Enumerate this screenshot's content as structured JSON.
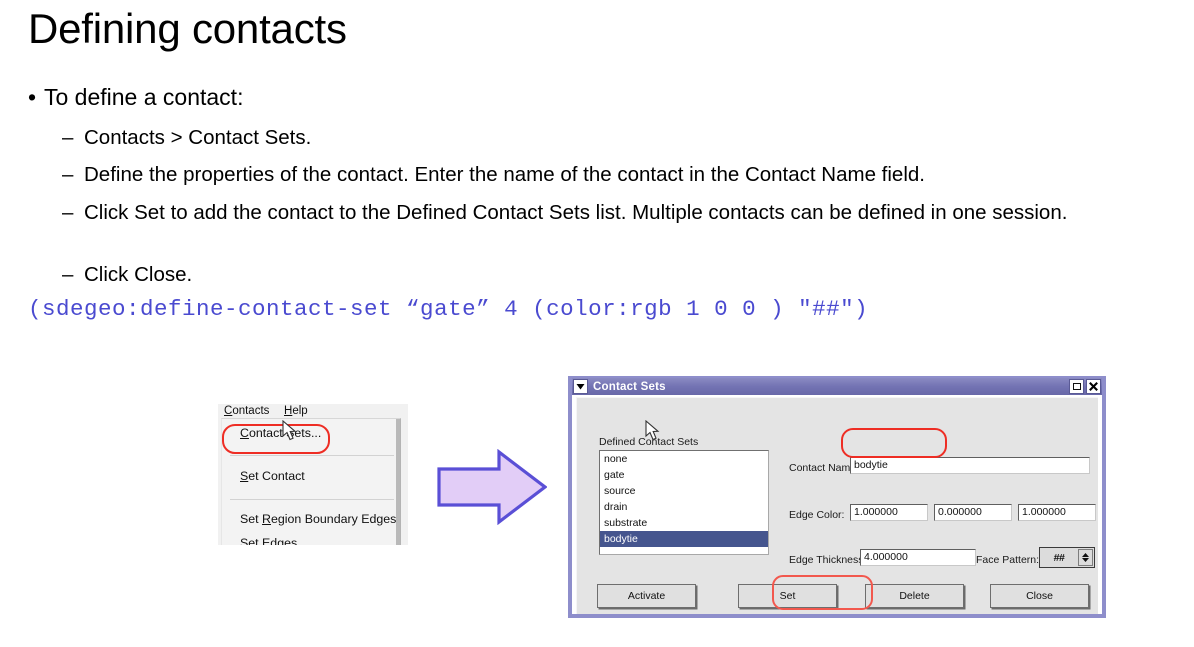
{
  "slide": {
    "title": "Defining contacts",
    "bullet": "To define a contact:",
    "bullet_marker": "•",
    "sub_marker": "–",
    "sub_bullets": [
      "Contacts > Contact Sets.",
      "Define the properties of the contact. Enter the name of the contact in the Contact Name field.",
      "Click Set to add the contact to the Defined Contact Sets list. Multiple contacts can be defined in one session.",
      "Click Close."
    ],
    "code_line": "(sdegeo:define-contact-set “gate” 4 (color:rgb 1 0 0 ) \"##\")",
    "code_color": "#4a4ad0"
  },
  "arrow": {
    "name": "right-arrow",
    "fill": "#e2cdf7",
    "stroke": "#5a4fd6"
  },
  "menu_capture": {
    "menubar": [
      {
        "label": "Contacts",
        "mnemonic": "C"
      },
      {
        "label": "Help",
        "mnemonic": "H"
      }
    ],
    "items": [
      {
        "label": "Contact Sets...",
        "mnemonic": "C",
        "highlighted": false
      },
      {
        "label": "Set Contact",
        "mnemonic": "S",
        "highlighted": false
      },
      {
        "label": "Set Region Boundary Edges",
        "mnemonic": "R",
        "highlighted": false
      },
      {
        "label": "Set Edges",
        "mnemonic": "S",
        "highlighted": false
      },
      {
        "label": "",
        "mnemonic": "",
        "highlighted": true
      }
    ],
    "annotation_color": "#ee2d24"
  },
  "dialog": {
    "title": "Contact Sets",
    "titlebar_color": "#7373b3",
    "window_menu_icon": "chevron-down-icon",
    "maximize_icon": "maximize-icon",
    "close_icon": "close-icon",
    "close_glyph": "✖",
    "chevron_glyph": "❯",
    "labels": {
      "defined_contact_sets": "Defined Contact Sets",
      "contact_name": "Contact Name:",
      "edge_color": "Edge Color:",
      "edge_thickness": "Edge Thickness:",
      "face_pattern": "Face Pattern:"
    },
    "list": {
      "items": [
        "none",
        "gate",
        "source",
        "drain",
        "substrate",
        "bodytie"
      ],
      "selected": "bodytie",
      "selected_color": "#45558e"
    },
    "fields": {
      "contact_name": "bodytie",
      "edge_color_r": "1.000000",
      "edge_color_g": "0.000000",
      "edge_color_b": "1.000000",
      "edge_thickness": "4.000000",
      "face_pattern": "##"
    },
    "buttons": [
      {
        "label": "Activate",
        "highlighted": false
      },
      {
        "label": "Set",
        "highlighted": true
      },
      {
        "label": "Delete",
        "highlighted": false
      },
      {
        "label": "Close",
        "highlighted": false
      }
    ]
  }
}
